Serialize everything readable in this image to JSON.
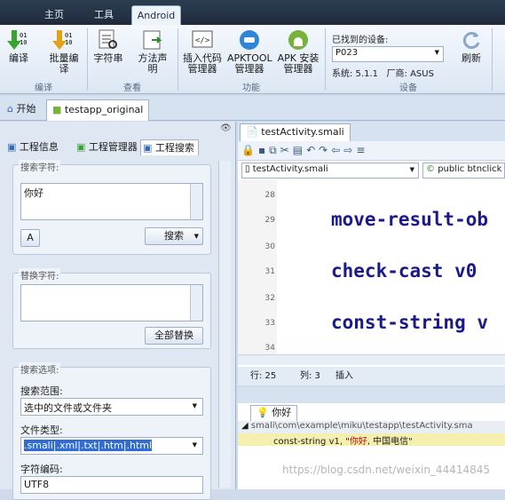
{
  "ribbon": {
    "tabs": [
      "主页",
      "工具",
      "Android"
    ],
    "active_tab": "Android",
    "groups": [
      {
        "label": "编译",
        "buttons": [
          "编译",
          "批量编译"
        ]
      },
      {
        "label": "查看",
        "buttons": [
          "字符串",
          "方法声明"
        ]
      },
      {
        "label": "功能",
        "buttons": [
          "插入代码管理器",
          "APKTOOL管理器",
          "APK 安装管理器"
        ]
      },
      {
        "label": "设备",
        "buttons": [
          "刷新"
        ]
      }
    ],
    "device": {
      "title": "已找到的设备:",
      "selected": "P023",
      "info": "系统: 5.1.1   厂商: ASUS"
    }
  },
  "doc_tabs": {
    "start": "开始",
    "project": "testapp_original"
  },
  "left_panel": {
    "tabs": [
      "工程信息",
      "工程管理器",
      "工程搜索"
    ],
    "search": {
      "title": "搜索字符:",
      "value": "你好",
      "button": "搜索"
    },
    "replace": {
      "title": "替换字符:",
      "value": "",
      "button": "全部替换"
    },
    "options": {
      "title": "搜索选项:",
      "scope_label": "搜索范围:",
      "scope_value": "选中的文件或文件夹",
      "type_label": "文件类型:",
      "type_value": ".smali|.xml|.txt|.htm|.html",
      "encoding_label": "字符编码:",
      "encoding_value": "UTF8"
    }
  },
  "editor": {
    "tab_label": "testActivity.smali",
    "file_combo": "testActivity.smali",
    "method_combo": "public btnclick",
    "lines": [
      {
        "num": "28",
        "code": ""
      },
      {
        "num": "29",
        "code": "move-result-ob"
      },
      {
        "num": "30",
        "code": ""
      },
      {
        "num": "31",
        "code": "check-cast v0"
      },
      {
        "num": "32",
        "code": ""
      },
      {
        "num": "33",
        "code": "const-string v"
      },
      {
        "num": "34",
        "code": ""
      }
    ],
    "status": {
      "row": "行: 25",
      "col": "列: 3",
      "mode": "插入"
    }
  },
  "results": {
    "tab_label": "你好",
    "path": "smali\\com\\example\\miku\\testapp\\testActivity.sma",
    "match_prefix": "const-string v1, \"",
    "match_hit": "你好",
    "match_suffix": ", 中国电信\""
  },
  "watermark": "https://blog.csdn.net/weixin_44414845",
  "colors": {
    "accent": "#1a1a8c",
    "hit": "#d40000",
    "ribbon_dark": "#1e2a3a"
  }
}
